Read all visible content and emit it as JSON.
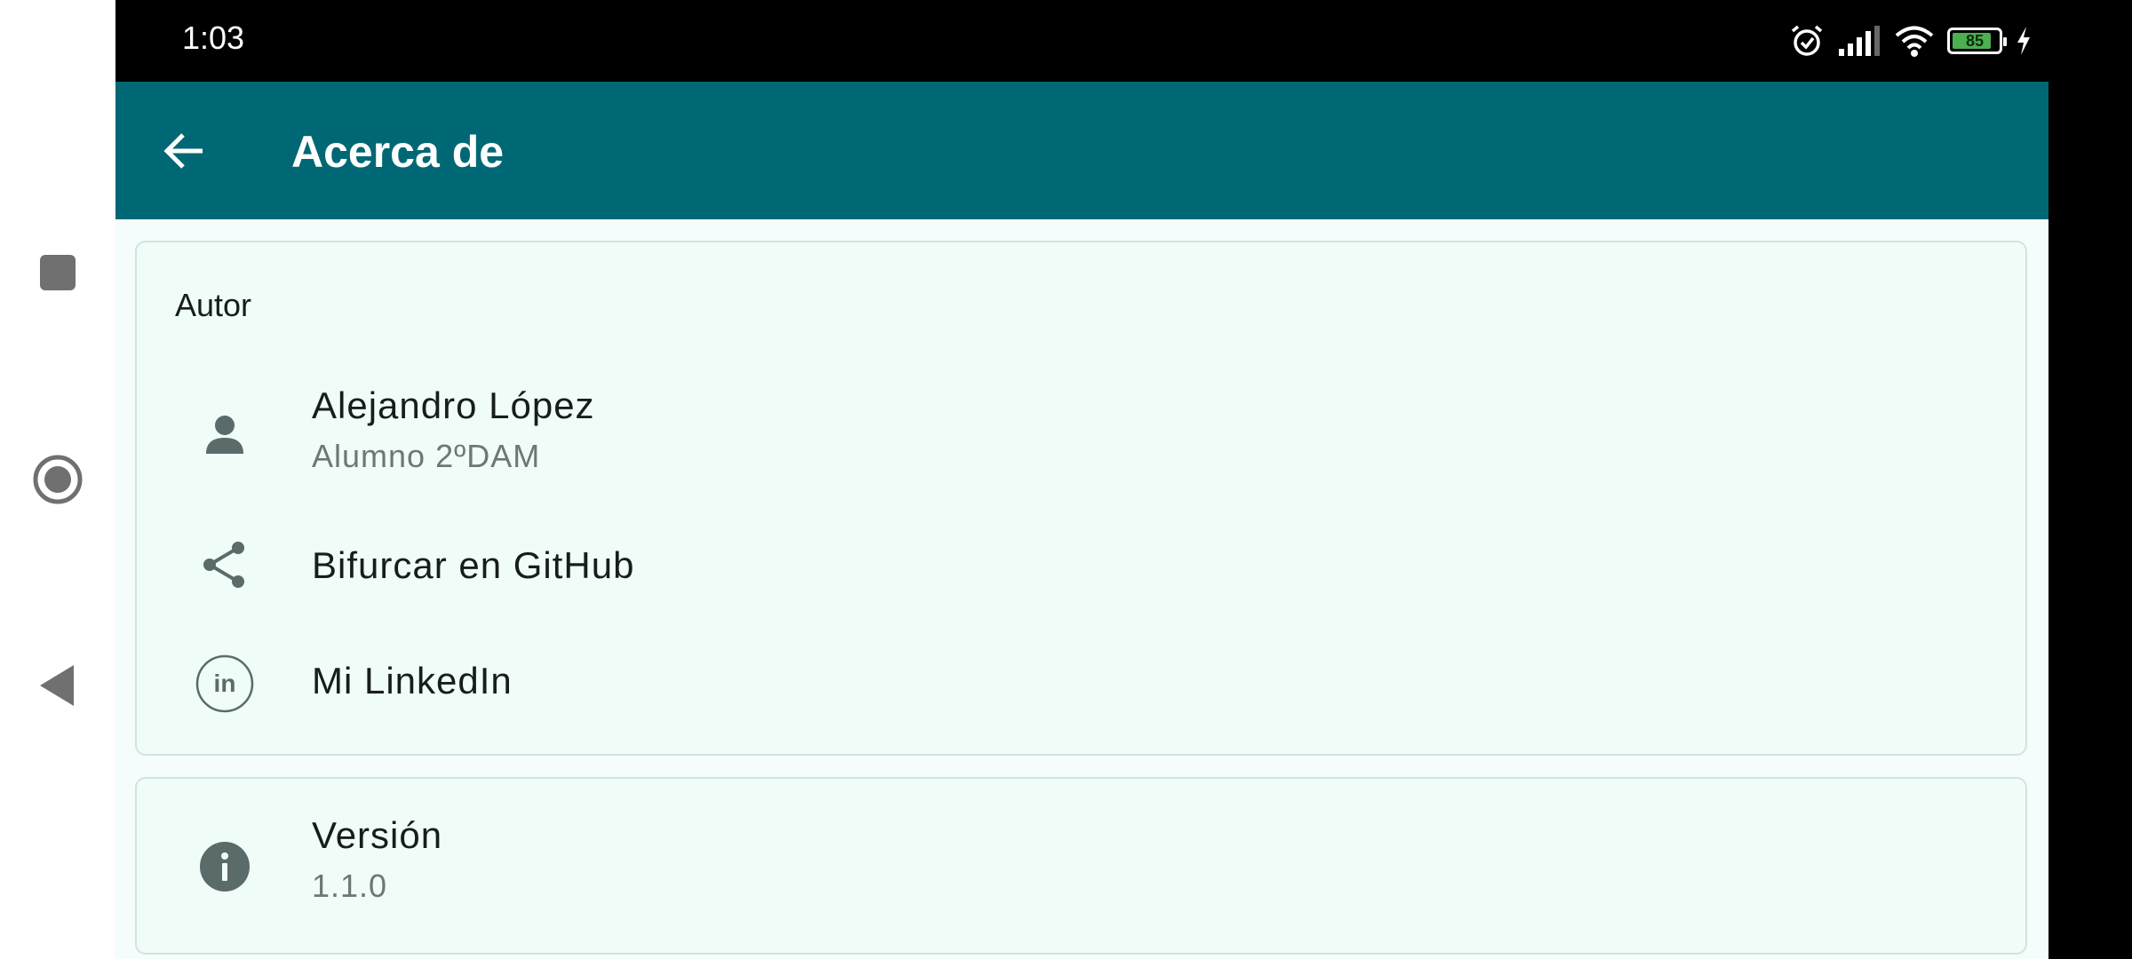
{
  "status_bar": {
    "time": "1:03",
    "battery_level": "85",
    "battery_fraction": 0.85,
    "icons": [
      "alarm-icon",
      "signal-icon",
      "wifi-icon",
      "battery-icon",
      "charging-icon"
    ]
  },
  "navigation": {
    "buttons": [
      "recents-icon",
      "home-icon",
      "back-icon"
    ]
  },
  "app_bar": {
    "title": "Acerca de",
    "back_icon": "arrow-back-icon"
  },
  "author_section": {
    "header": "Autor",
    "items": [
      {
        "icon": "person-icon",
        "title": "Alejandro López",
        "subtitle": "Alumno 2ºDAM"
      },
      {
        "icon": "share-icon",
        "title": "Bifurcar en GitHub"
      },
      {
        "icon": "linkedin-icon",
        "title": "Mi LinkedIn"
      }
    ]
  },
  "version_section": {
    "items": [
      {
        "icon": "info-icon",
        "title": "Versión",
        "subtitle": "1.1.0"
      }
    ]
  },
  "colors": {
    "app_bar": "#006874",
    "content_background": "#f4fdfb",
    "card_background": "#effcf8",
    "icon": "#5a6b69",
    "battery_fill": "#4caf50"
  }
}
